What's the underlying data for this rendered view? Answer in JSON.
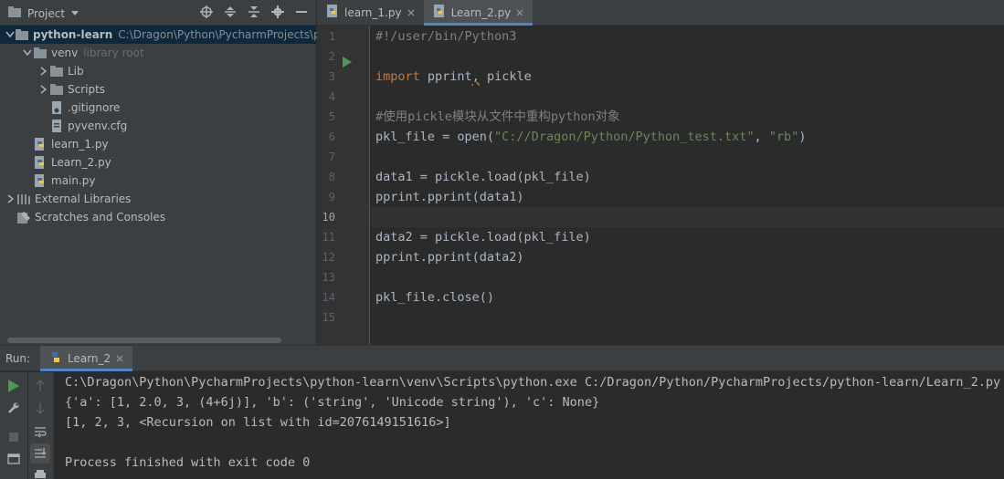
{
  "project": {
    "title": "Project",
    "tree": [
      {
        "label": "python-learn",
        "hint": "C:\\Dragon\\Python\\PycharmProjects\\pytho",
        "indent": 0,
        "arrow": "down",
        "icon": "folder-icon",
        "bold": true,
        "selected": true
      },
      {
        "label": "venv",
        "hint": "library root",
        "indent": 1,
        "arrow": "down",
        "icon": "folder-icon"
      },
      {
        "label": "Lib",
        "indent": 2,
        "arrow": "right",
        "icon": "folder-icon"
      },
      {
        "label": "Scripts",
        "indent": 2,
        "arrow": "right",
        "icon": "folder-icon"
      },
      {
        "label": ".gitignore",
        "indent": 2,
        "arrow": "none",
        "icon": "file-ignore-icon"
      },
      {
        "label": "pyvenv.cfg",
        "indent": 2,
        "arrow": "none",
        "icon": "file-config-icon"
      },
      {
        "label": "learn_1.py",
        "indent": 1,
        "arrow": "none",
        "icon": "python-file-icon"
      },
      {
        "label": "Learn_2.py",
        "indent": 1,
        "arrow": "none",
        "icon": "python-file-icon"
      },
      {
        "label": "main.py",
        "indent": 1,
        "arrow": "none",
        "icon": "python-file-icon"
      },
      {
        "label": "External Libraries",
        "indent": 0,
        "arrow": "right",
        "icon": "libraries-icon"
      },
      {
        "label": "Scratches and Consoles",
        "indent": 0,
        "arrow": "none",
        "icon": "scratches-icon"
      }
    ]
  },
  "editor": {
    "tabs": [
      {
        "label": "learn_1.py",
        "active": false
      },
      {
        "label": "Learn_2.py",
        "active": true
      }
    ],
    "current_line": 10,
    "lines": [
      {
        "n": "1",
        "text": "#!/user/bin/Python3"
      },
      {
        "n": "2",
        "text": ""
      },
      {
        "n": "3",
        "text": "import pprint, pickle"
      },
      {
        "n": "4",
        "text": ""
      },
      {
        "n": "5",
        "text": "#使用pickle模块从文件中重构python对象"
      },
      {
        "n": "6",
        "text": "pkl_file = open(\"C://Dragon/Python/Python_test.txt\", \"rb\")"
      },
      {
        "n": "7",
        "text": ""
      },
      {
        "n": "8",
        "text": "data1 = pickle.load(pkl_file)"
      },
      {
        "n": "9",
        "text": "pprint.pprint(data1)"
      },
      {
        "n": "10",
        "text": ""
      },
      {
        "n": "11",
        "text": "data2 = pickle.load(pkl_file)"
      },
      {
        "n": "12",
        "text": "pprint.pprint(data2)"
      },
      {
        "n": "13",
        "text": ""
      },
      {
        "n": "14",
        "text": "pkl_file.close()"
      },
      {
        "n": "15",
        "text": ""
      }
    ]
  },
  "run": {
    "label": "Run:",
    "tab_label": "Learn_2",
    "console": [
      "C:\\Dragon\\Python\\PycharmProjects\\python-learn\\venv\\Scripts\\python.exe C:/Dragon/Python/PycharmProjects/python-learn/Learn_2.py",
      "{'a': [1, 2.0, 3, (4+6j)], 'b': ('string', 'Unicode string'), 'c': None}",
      "[1, 2, 3, <Recursion on list with id=2076149151616>]",
      "",
      "Process finished with exit code 0"
    ]
  },
  "colors": {
    "accent": "#4a88c7",
    "keyword": "#cc7832",
    "string": "#6a8759",
    "comment": "#808080",
    "run_green": "#499c54"
  }
}
